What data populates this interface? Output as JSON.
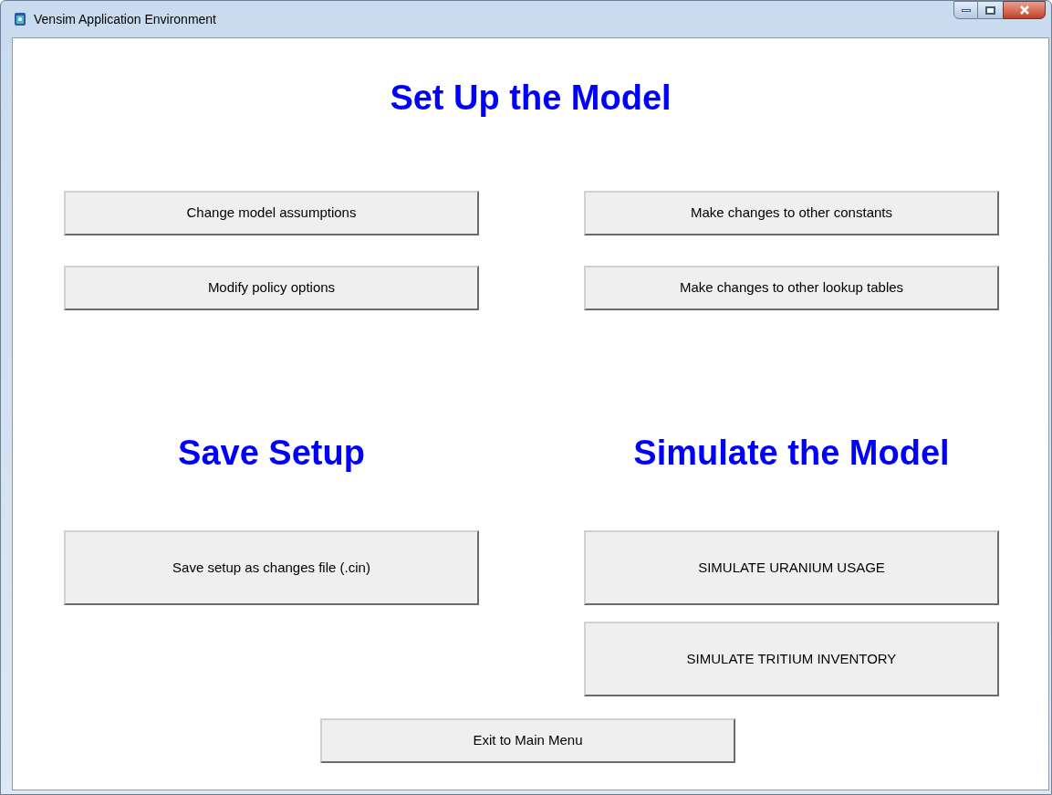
{
  "window": {
    "title": "Vensim Application Environment"
  },
  "setup": {
    "heading": "Set Up the Model",
    "buttons": [
      "Change model assumptions",
      "Make changes to other constants",
      "Modify policy options",
      "Make changes to other lookup tables"
    ]
  },
  "save": {
    "heading": "Save Setup",
    "buttons": [
      "Save setup as changes file (.cin)"
    ]
  },
  "simulate": {
    "heading": "Simulate the Model",
    "buttons": [
      "SIMULATE URANIUM USAGE",
      "SIMULATE TRITIUM INVENTORY"
    ]
  },
  "exit_button": "Exit to Main Menu"
}
